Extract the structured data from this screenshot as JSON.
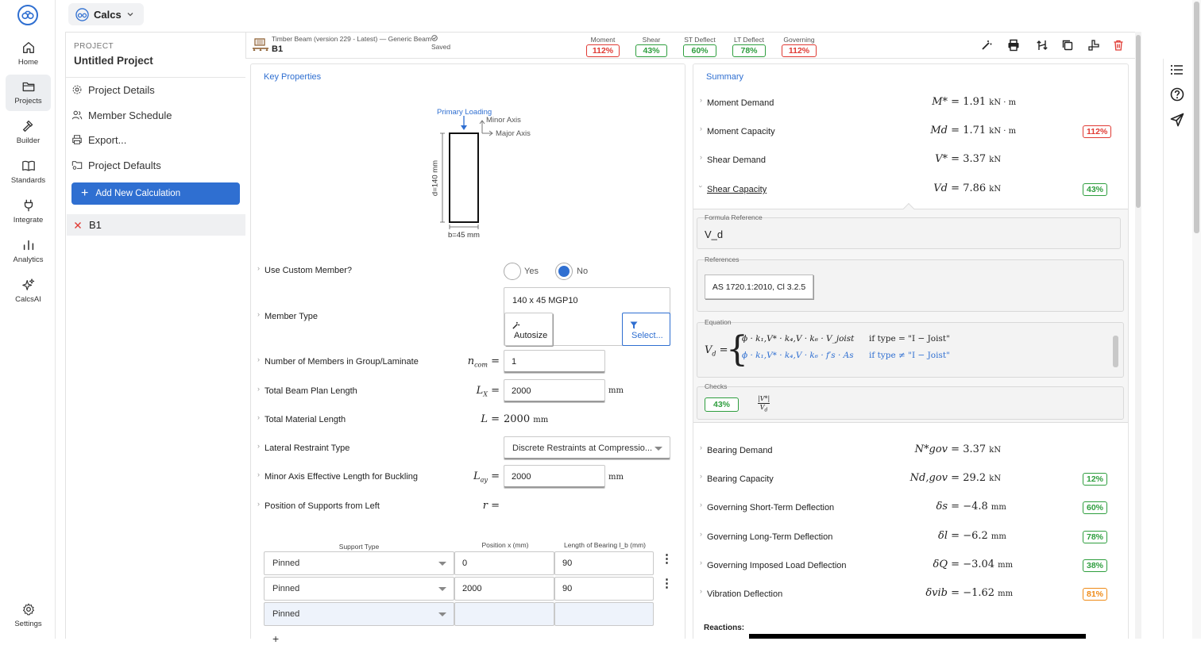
{
  "app": {
    "name": "Calcs"
  },
  "nav": [
    {
      "key": "home",
      "label": "Home",
      "icon": "home-icon"
    },
    {
      "key": "projects",
      "label": "Projects",
      "icon": "folder-icon",
      "active": true
    },
    {
      "key": "builder",
      "label": "Builder",
      "icon": "hammer-icon"
    },
    {
      "key": "standards",
      "label": "Standards",
      "icon": "book-icon"
    },
    {
      "key": "integrate",
      "label": "Integrate",
      "icon": "plug-icon"
    },
    {
      "key": "analytics",
      "label": "Analytics",
      "icon": "bar-chart-icon"
    },
    {
      "key": "calcsai",
      "label": "CalcsAI",
      "icon": "sparkle-icon"
    }
  ],
  "nav_settings": "Settings",
  "project": {
    "label": "PROJECT",
    "title": "Untitled Project",
    "menu": [
      "Project Details",
      "Member Schedule",
      "Export...",
      "Project Defaults"
    ],
    "add_button": "Add New Calculation",
    "members": [
      "B1"
    ]
  },
  "header": {
    "calc_title": "Timber Beam (version 229 - Latest) — Generic Beam",
    "member": "B1",
    "saved": "Saved",
    "utils": [
      {
        "label": "Moment",
        "value": "112%",
        "status": "red"
      },
      {
        "label": "Shear",
        "value": "43%",
        "status": "green"
      },
      {
        "label": "ST Deflect",
        "value": "60%",
        "status": "green"
      },
      {
        "label": "LT Deflect",
        "value": "78%",
        "status": "green"
      },
      {
        "label": "Governing",
        "value": "112%",
        "status": "red"
      }
    ]
  },
  "key_props": {
    "title": "Key Properties",
    "diagram": {
      "primary_loading": "Primary Loading",
      "minor_axis": "Minor Axis",
      "major_axis": "Major Axis",
      "depth": "d=140 mm",
      "breadth": "b=45 mm"
    },
    "custom_member": {
      "label": "Use Custom Member?",
      "yes": "Yes",
      "no": "No",
      "selected": "No"
    },
    "member_type": {
      "label": "Member Type",
      "value": "140 x 45 MGP10",
      "autosize": "Autosize",
      "select": "Select..."
    },
    "n_members": {
      "label": "Number of Members in Group/Laminate",
      "symbol": "n",
      "sub": "com",
      "value": "1"
    },
    "beam_length": {
      "label": "Total Beam Plan Length",
      "symbol": "L",
      "sub": "X",
      "value": "2000",
      "unit": "mm"
    },
    "material_length": {
      "label": "Total Material Length",
      "symbol": "L",
      "value": "2000",
      "unit": "mm"
    },
    "restraint": {
      "label": "Lateral Restraint Type",
      "value": "Discrete Restraints at Compressio..."
    },
    "eff_length": {
      "label": "Minor Axis Effective Length for Buckling",
      "symbol": "L",
      "sub": "ay",
      "value": "2000",
      "unit": "mm"
    },
    "supports_pos": {
      "label": "Position of Supports from Left",
      "symbol": "r"
    },
    "support_table": {
      "headers": [
        "Support Type",
        "Position x (mm)",
        "Length of Bearing l_b (mm)"
      ],
      "rows": [
        {
          "type": "Pinned",
          "position": "0",
          "bearing": "90"
        },
        {
          "type": "Pinned",
          "position": "2000",
          "bearing": "90"
        },
        {
          "type": "Pinned",
          "position": "",
          "bearing": ""
        }
      ]
    }
  },
  "summary": {
    "title": "Summary",
    "rows_top": [
      {
        "label": "Moment Demand",
        "sym": "M*",
        "eq": "=",
        "value": "1.91",
        "unit": "kN · m",
        "badge": ""
      },
      {
        "label": "Moment Capacity",
        "sym": "Md",
        "eq": "=",
        "value": "1.71",
        "unit": "kN · m",
        "badge": "112%",
        "status": "red"
      },
      {
        "label": "Shear Demand",
        "sym": "V*",
        "eq": "=",
        "value": "3.37",
        "unit": "kN",
        "badge": ""
      },
      {
        "label": "Shear Capacity",
        "sym": "Vd",
        "eq": "=",
        "value": "7.86",
        "unit": "kN",
        "badge": "43%",
        "status": "green"
      }
    ],
    "detail": {
      "formula_ref_label": "Formula Reference",
      "formula_ref": "V_d",
      "references_label": "References",
      "reference": "AS 1720.1:2010, Cl 3.2.5",
      "equation_label": "Equation",
      "eq_line1": "ϕ · k₁,V* · k₄,V · k₆ · V_joist",
      "eq_cond1": "if type = \"I − Joist\"",
      "eq_line2": "ϕ · k₁,V* · k₄,V · k₆ · f′s · As",
      "eq_cond2": "if type ≠ \"I − Joist\"",
      "checks_label": "Checks",
      "check_value": "43%"
    },
    "rows_bottom": [
      {
        "label": "Bearing Demand",
        "sym": "N*gov",
        "eq": "=",
        "value": "3.37",
        "unit": "kN",
        "badge": ""
      },
      {
        "label": "Bearing Capacity",
        "sym": "Nd,gov",
        "eq": "=",
        "value": "29.2",
        "unit": "kN",
        "badge": "12%",
        "status": "green"
      },
      {
        "label": "Governing Short-Term Deflection",
        "sym": "δs",
        "eq": "=",
        "value": "−4.8",
        "unit": "mm",
        "badge": "60%",
        "status": "green"
      },
      {
        "label": "Governing Long-Term Deflection",
        "sym": "δl",
        "eq": "=",
        "value": "−6.2",
        "unit": "mm",
        "badge": "78%",
        "status": "green"
      },
      {
        "label": "Governing Imposed Load Deflection",
        "sym": "δQ",
        "eq": "=",
        "value": "−3.04",
        "unit": "mm",
        "badge": "38%",
        "status": "green"
      },
      {
        "label": "Vibration Deflection",
        "sym": "δvib",
        "eq": "=",
        "value": "−1.62",
        "unit": "mm",
        "badge": "81%",
        "status": "orange"
      }
    ],
    "reactions_label": "Reactions:"
  }
}
